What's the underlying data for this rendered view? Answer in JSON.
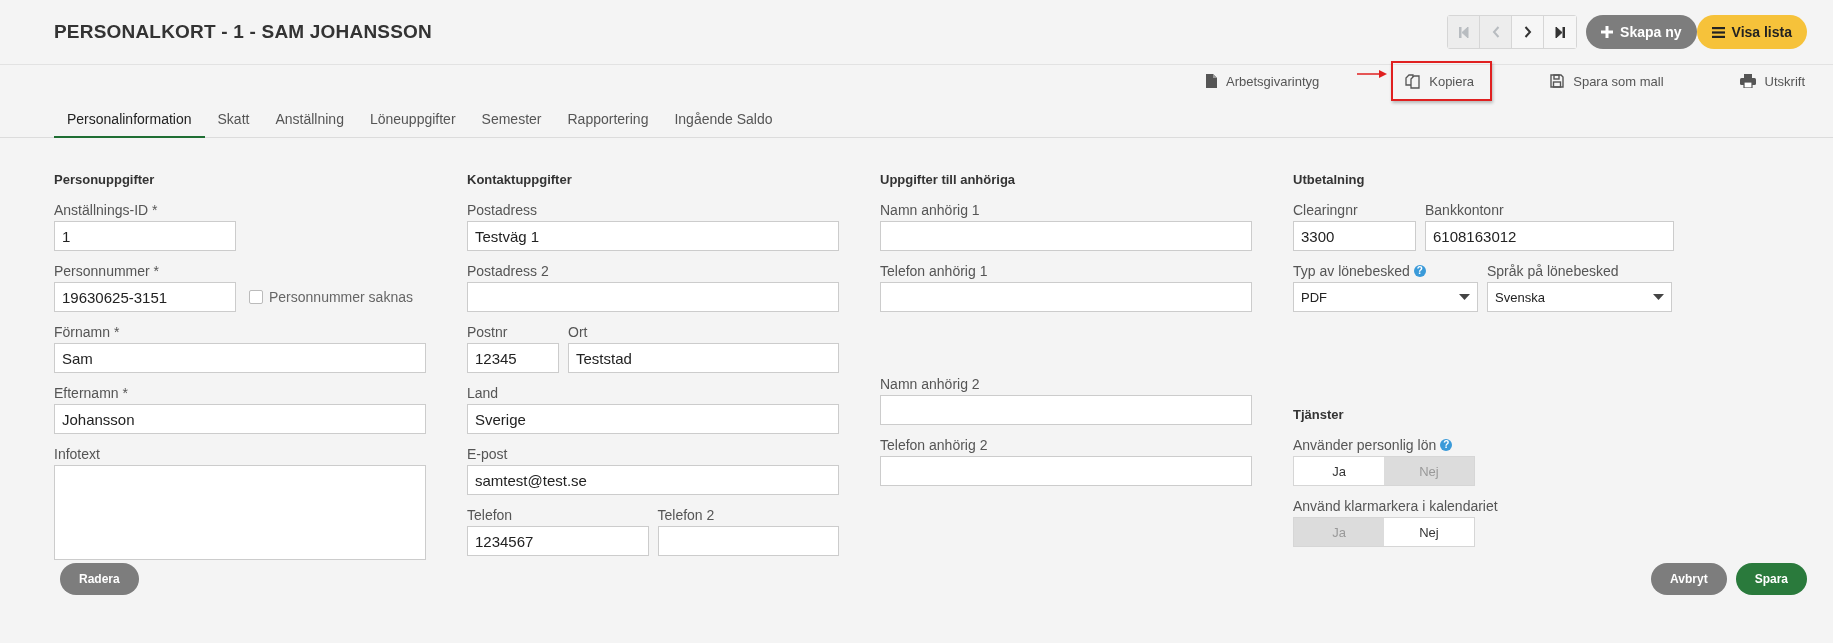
{
  "title": "PERSONALKORT - 1 - SAM JOHANSSON",
  "nav_buttons": [
    {
      "kind": "first",
      "disabled": true
    },
    {
      "kind": "prev",
      "disabled": true
    },
    {
      "kind": "next",
      "disabled": false
    },
    {
      "kind": "last",
      "disabled": false
    }
  ],
  "header_buttons": [
    {
      "kind": "create",
      "label": "Skapa ny"
    },
    {
      "kind": "list",
      "label": "Visa lista"
    }
  ],
  "actions": [
    {
      "kind": "certificate",
      "label": "Arbetsgivarintyg",
      "highlighted": false
    },
    {
      "kind": "copy",
      "label": "Kopiera",
      "highlighted": true
    },
    {
      "kind": "save",
      "label": "Spara som mall",
      "highlighted": false
    },
    {
      "kind": "print",
      "label": "Utskrift",
      "highlighted": false
    }
  ],
  "tabs": [
    {
      "label": "Personalinformation",
      "selected": true
    },
    {
      "label": "Skatt",
      "selected": false
    },
    {
      "label": "Anställning",
      "selected": false
    },
    {
      "label": "Löneuppgifter",
      "selected": false
    },
    {
      "label": "Semester",
      "selected": false
    },
    {
      "label": "Rapportering",
      "selected": false
    },
    {
      "label": "Ingående Saldo",
      "selected": false
    }
  ],
  "columns": [
    {
      "groups": [
        {
          "heading": "Personuppgifter",
          "rows": [
            [
              {
                "kind": "text",
                "label": "Anställnings-ID *",
                "value": "1"
              }
            ],
            [
              {
                "kind": "text",
                "label": "Personnummer *",
                "value": "19630625-3151"
              },
              {
                "kind": "checkbox",
                "label": "Personnummer saknas",
                "checked": false
              }
            ],
            [
              {
                "kind": "text",
                "label": "Förnamn *",
                "value": "Sam"
              }
            ],
            [
              {
                "kind": "text",
                "label": "Efternamn *",
                "value": "Johansson"
              }
            ],
            [
              {
                "kind": "textarea",
                "label": "Infotext"
              }
            ]
          ]
        }
      ]
    },
    {
      "groups": [
        {
          "heading": "Kontaktuppgifter",
          "rows": [
            [
              {
                "kind": "text",
                "label": "Postadress",
                "value": "Testväg 1"
              }
            ],
            [
              {
                "kind": "text",
                "label": "Postadress 2"
              }
            ],
            [
              {
                "kind": "text",
                "label": "Postnr",
                "value": "12345"
              },
              {
                "kind": "text",
                "label": "Ort",
                "value": "Teststad"
              }
            ],
            [
              {
                "kind": "text",
                "label": "Land",
                "value": "Sverige"
              }
            ],
            [
              {
                "kind": "text",
                "label": "E-post",
                "value": "samtest@test.se"
              }
            ],
            [
              {
                "kind": "text",
                "label": "Telefon",
                "value": "1234567"
              },
              {
                "kind": "text",
                "label": "Telefon 2"
              }
            ]
          ]
        }
      ]
    },
    {
      "groups": [
        {
          "heading": "Uppgifter till anhöriga",
          "rows": [
            [
              {
                "kind": "text",
                "label": "Namn anhörig 1"
              }
            ],
            [
              {
                "kind": "text",
                "label": "Telefon anhörig 1"
              }
            ]
          ]
        },
        {
          "rows": [
            [
              {
                "kind": "text",
                "label": "Namn anhörig 2"
              }
            ],
            [
              {
                "kind": "text",
                "label": "Telefon anhörig 2"
              }
            ]
          ]
        }
      ]
    },
    {
      "groups": [
        {
          "heading": "Utbetalning",
          "rows": [
            [
              {
                "kind": "text",
                "label": "Clearingnr",
                "value": "3300"
              },
              {
                "kind": "text",
                "label": "Bankkontonr",
                "value": "6108163012"
              }
            ],
            [
              {
                "kind": "select",
                "label": "Typ av lönebesked",
                "help_icon": "?",
                "value": "PDF"
              },
              {
                "kind": "select",
                "label": "Språk på lönebesked",
                "value": "Svenska"
              }
            ]
          ]
        },
        {
          "heading": "Tjänster",
          "rows": [
            [
              {
                "kind": "toggle",
                "label": "Använder personlig lön",
                "help_icon": "?",
                "options": [
                  {
                    "label": "Ja",
                    "selected": true
                  },
                  {
                    "label": "Nej",
                    "selected": false
                  }
                ]
              }
            ],
            [
              {
                "kind": "toggle",
                "label": "Använd klarmarkera i kalendariet",
                "options": [
                  {
                    "label": "Ja",
                    "selected": false
                  },
                  {
                    "label": "Nej",
                    "selected": true
                  }
                ]
              }
            ]
          ]
        }
      ]
    }
  ],
  "footer_left": [
    {
      "label": "Radera"
    }
  ],
  "footer_right": [
    {
      "kind": "cancel",
      "label": "Avbryt"
    },
    {
      "kind": "save",
      "label": "Spara"
    }
  ]
}
